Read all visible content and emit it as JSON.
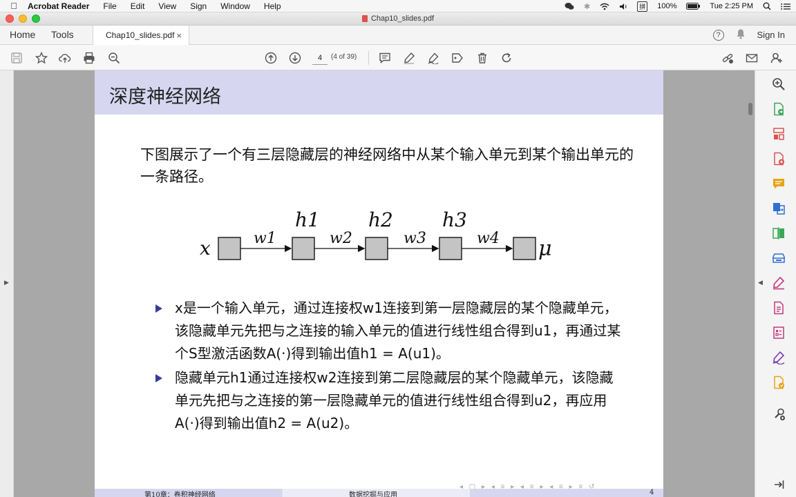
{
  "menubar": {
    "app_name": "Acrobat Reader",
    "items": [
      "File",
      "Edit",
      "View",
      "Sign",
      "Window",
      "Help"
    ],
    "battery": "100%",
    "clock": "Tue 2:25 PM"
  },
  "window": {
    "title": "Chap10_slides.pdf"
  },
  "tabs": {
    "home": "Home",
    "tools": "Tools",
    "document": "Chap10_slides.pdf",
    "close_glyph": "×",
    "help_glyph": "?",
    "sign_in": "Sign In"
  },
  "toolbar": {
    "page_number": "4",
    "page_of": "(4 of 39)"
  },
  "slide": {
    "title": "深度神经网络",
    "intro": "下图展示了一个有三层隐藏层的神经网络中从某个输入单元到某个输出单元的一条路径。",
    "diagram": {
      "input_label": "x",
      "output_label": "μ",
      "hidden_labels": [
        "h1",
        "h2",
        "h3"
      ],
      "weight_labels": [
        "w1",
        "w2",
        "w3",
        "w4"
      ]
    },
    "bullets": [
      "x是一个输入单元，通过连接权w1连接到第一层隐藏层的某个隐藏单元，该隐藏单元先把与之连接的输入单元的值进行线性组合得到u1，再通过某个S型激活函数A(·)得到输出值h1 = A(u1)。",
      "隐藏单元h1通过连接权w2连接到第二层隐藏层的某个隐藏单元，该隐藏单元先把与之连接的第一层隐藏单元的值进行线性组合得到u2，再应用A(·)得到输出值h2 = A(u2)。"
    ],
    "footer": {
      "left": "第10章：卷积神经网络",
      "center": "数据挖掘与应用",
      "page": "4"
    }
  },
  "colors": {
    "title_bar": "#d6d6f0",
    "bullet_marker": "#3a3a9a",
    "canvas_bg": "#a8a8a8"
  }
}
